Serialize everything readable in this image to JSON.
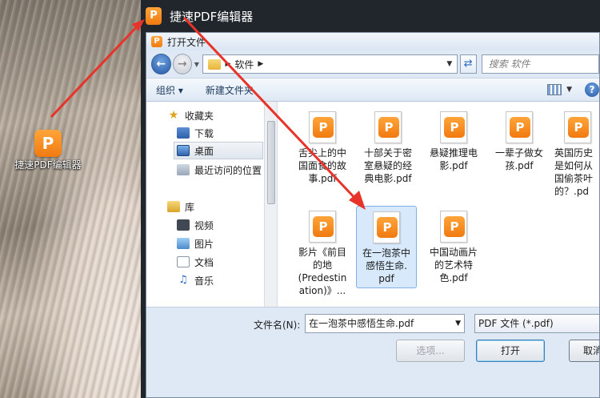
{
  "desktop": {
    "icon_letter": "P",
    "icon_label": "捷速PDF编辑器"
  },
  "app": {
    "logo_letter": "P",
    "title": "捷速PDF编辑器"
  },
  "dialog": {
    "title": "打开文件",
    "icon_letter": "P",
    "address": {
      "folder": "软件"
    },
    "search_placeholder": "搜索 软件",
    "toolbar": {
      "organize": "组织 ▾",
      "new_folder": "新建文件夹"
    },
    "nav": [
      {
        "label": "收藏夹",
        "icon": "star-icon"
      },
      {
        "label": "下载",
        "icon": "download-folder-icon"
      },
      {
        "label": "桌面",
        "icon": "desktop-icon",
        "selected": true
      },
      {
        "label": "最近访问的位置",
        "icon": "recent-places-icon"
      },
      {
        "label": "库",
        "icon": "library-icon"
      },
      {
        "label": "视频",
        "icon": "video-icon"
      },
      {
        "label": "图片",
        "icon": "picture-icon"
      },
      {
        "label": "文档",
        "icon": "document-icon"
      },
      {
        "label": "音乐",
        "icon": "music-icon"
      }
    ],
    "files": [
      {
        "name": "舌尖上的中国面食的故事.pdf",
        "lines": [
          "舌尖上的中",
          "国面食的故",
          "事.pdf"
        ]
      },
      {
        "name": "十部关于密室悬疑的经典电影.pdf",
        "lines": [
          "十部关于密",
          "室悬疑的经",
          "典电影.pdf"
        ]
      },
      {
        "name": "悬疑推理电影.pdf",
        "lines": [
          "悬疑推理电",
          "影.pdf"
        ]
      },
      {
        "name": "一辈子做女孩.pdf",
        "lines": [
          "一辈子做女",
          "孩.pdf"
        ]
      },
      {
        "name": "英国历史是如何从中国偷茶叶的？.pdf",
        "lines": [
          "英国历史",
          "是如何从",
          "国偷茶叶",
          "的？.pd"
        ]
      },
      {
        "name": "影片《前目的地(Predestination)》",
        "lines": [
          "影片《前目",
          "的地",
          "(Predestin",
          "ation)》..."
        ]
      },
      {
        "name": "在一泡茶中感悟生命.pdf",
        "lines": [
          "在一泡茶中",
          "感悟生命.",
          "pdf"
        ],
        "selected": true
      },
      {
        "name": "中国动画片的艺术特色.pdf",
        "lines": [
          "中国动画片",
          "的艺术特",
          "色.pdf"
        ]
      }
    ],
    "filename_label": "文件名(N):",
    "filename_value": "在一泡茶中感悟生命.pdf",
    "filetype_value": "PDF 文件 (*.pdf)",
    "options_button": "选项...",
    "open_button": "打开",
    "cancel_button": "取消"
  },
  "colors": {
    "accent_orange": "#f07a10",
    "selection_blue": "#d8e9fb",
    "arrow_red": "#e8332a"
  }
}
